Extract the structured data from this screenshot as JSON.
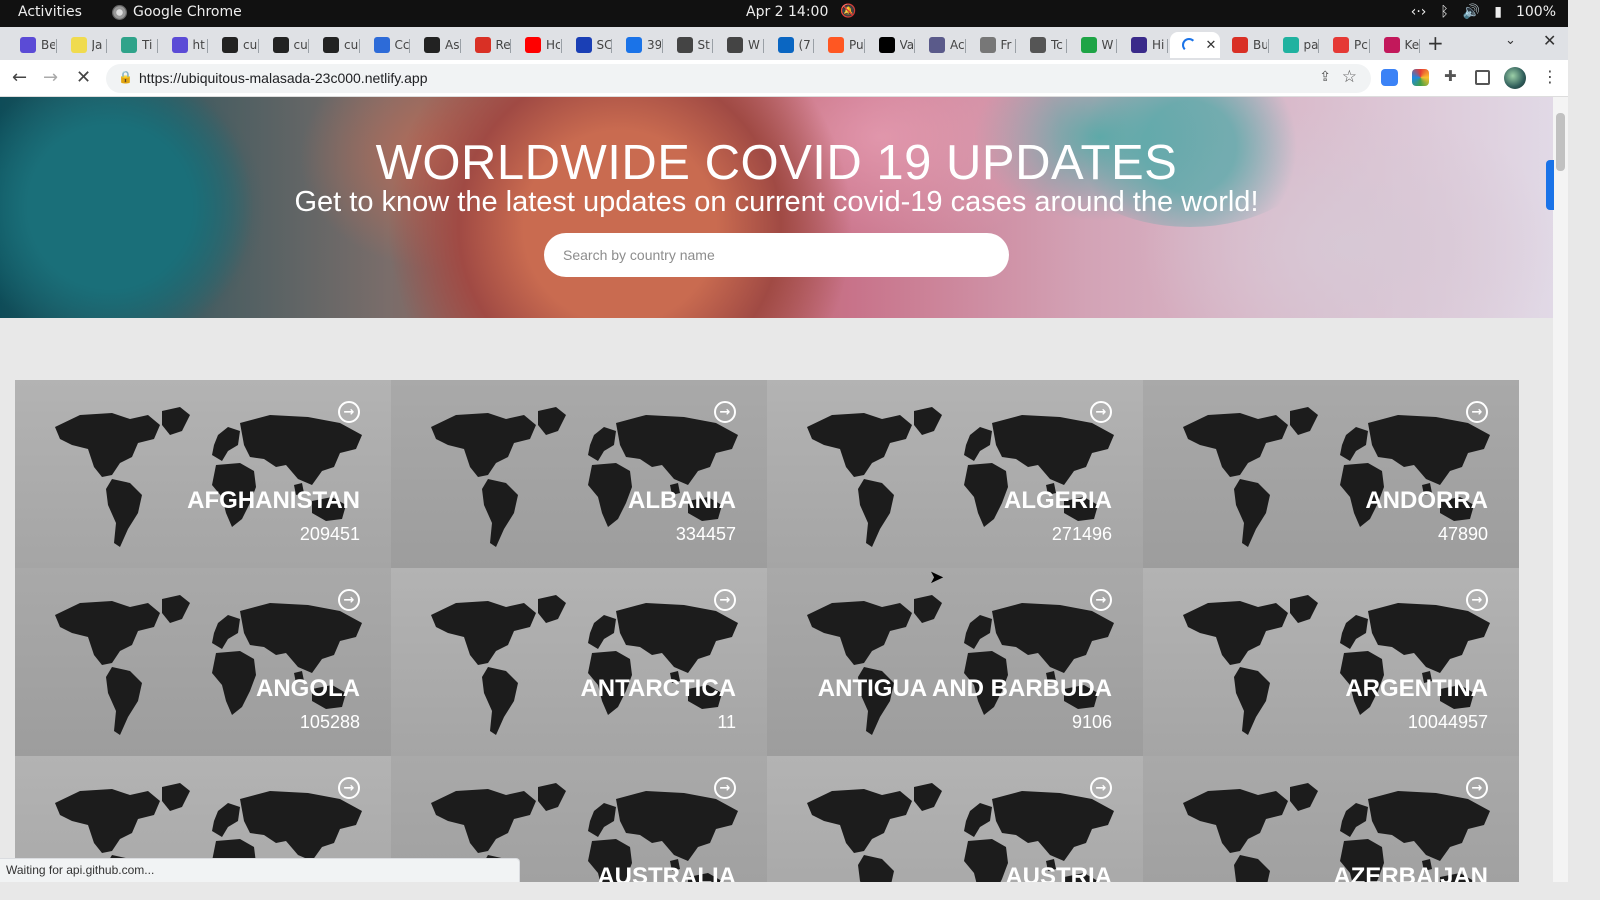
{
  "system": {
    "activities": "Activities",
    "app_name": "Google Chrome",
    "clock": "Apr 2  14:00",
    "battery": "100%"
  },
  "browser": {
    "tabs": [
      {
        "label": "Be",
        "icon": "tab-favicon",
        "color": "#5b4bd6"
      },
      {
        "label": "Ja",
        "icon": "js-icon",
        "color": "#f0db4f"
      },
      {
        "label": "Ti",
        "icon": "tab-favicon",
        "color": "#2fa38a"
      },
      {
        "label": "ht",
        "icon": "tab-favicon",
        "color": "#5b4bd6"
      },
      {
        "label": "cu",
        "icon": "github-icon",
        "color": "#222222"
      },
      {
        "label": "cu",
        "icon": "github-icon",
        "color": "#222222"
      },
      {
        "label": "cu",
        "icon": "github-icon",
        "color": "#222222"
      },
      {
        "label": "Cc",
        "icon": "docs-icon",
        "color": "#2d6bd8"
      },
      {
        "label": "As",
        "icon": "github-icon",
        "color": "#222222"
      },
      {
        "label": "Re",
        "icon": "tab-favicon",
        "color": "#d93025"
      },
      {
        "label": "Hc",
        "icon": "youtube-icon",
        "color": "#ff0000"
      },
      {
        "label": "SC",
        "icon": "tab-favicon",
        "color": "#1a3fb5"
      },
      {
        "label": "39",
        "icon": "tab-favicon",
        "color": "#1a73e8"
      },
      {
        "label": "St",
        "icon": "tab-favicon",
        "color": "#444444"
      },
      {
        "label": "W",
        "icon": "tab-favicon",
        "color": "#444444"
      },
      {
        "label": "(7",
        "icon": "linkedin-icon",
        "color": "#0a66c2"
      },
      {
        "label": "Pu",
        "icon": "tab-favicon",
        "color": "#ff5722"
      },
      {
        "label": "Va",
        "icon": "dev-icon",
        "color": "#000000"
      },
      {
        "label": "Ac",
        "icon": "tab-favicon",
        "color": "#5a5a8a"
      },
      {
        "label": "Fr",
        "icon": "tab-favicon",
        "color": "#777777"
      },
      {
        "label": "Tc",
        "icon": "tab-favicon",
        "color": "#555555"
      },
      {
        "label": "W",
        "icon": "tab-favicon",
        "color": "#1ea446"
      },
      {
        "label": "Hi",
        "icon": "tab-favicon",
        "color": "#3a2a8a"
      },
      {
        "label": "Bu",
        "icon": "tab-favicon",
        "color": "#d93025"
      },
      {
        "label": "pa",
        "icon": "tab-favicon",
        "color": "#20b2a0"
      },
      {
        "label": "Pc",
        "icon": "tab-favicon",
        "color": "#e53935"
      },
      {
        "label": "Ke",
        "icon": "tab-favicon",
        "color": "#c2185b"
      }
    ],
    "url": "https://ubiquitous-malasada-23c000.netlify.app",
    "status_text": "Waiting for api.github.com..."
  },
  "page": {
    "title": "WORLDWIDE COVID 19 UPDATES",
    "subtitle": "Get to know the latest updates on current covid-19 cases around the world!",
    "search_placeholder": "Search by country name",
    "countries": [
      {
        "name": "AFGHANISTAN",
        "cases": "209451"
      },
      {
        "name": "ALBANIA",
        "cases": "334457"
      },
      {
        "name": "ALGERIA",
        "cases": "271496"
      },
      {
        "name": "ANDORRA",
        "cases": "47890"
      },
      {
        "name": "ANGOLA",
        "cases": "105288"
      },
      {
        "name": "ANTARCTICA",
        "cases": "11"
      },
      {
        "name": "ANTIGUA AND BARBUDA",
        "cases": "9106"
      },
      {
        "name": "ARGENTINA",
        "cases": "10044957"
      },
      {
        "name": "",
        "cases": ""
      },
      {
        "name": "AUSTRALIA",
        "cases": ""
      },
      {
        "name": "AUSTRIA",
        "cases": ""
      },
      {
        "name": "AZERBAIJAN",
        "cases": ""
      }
    ]
  }
}
